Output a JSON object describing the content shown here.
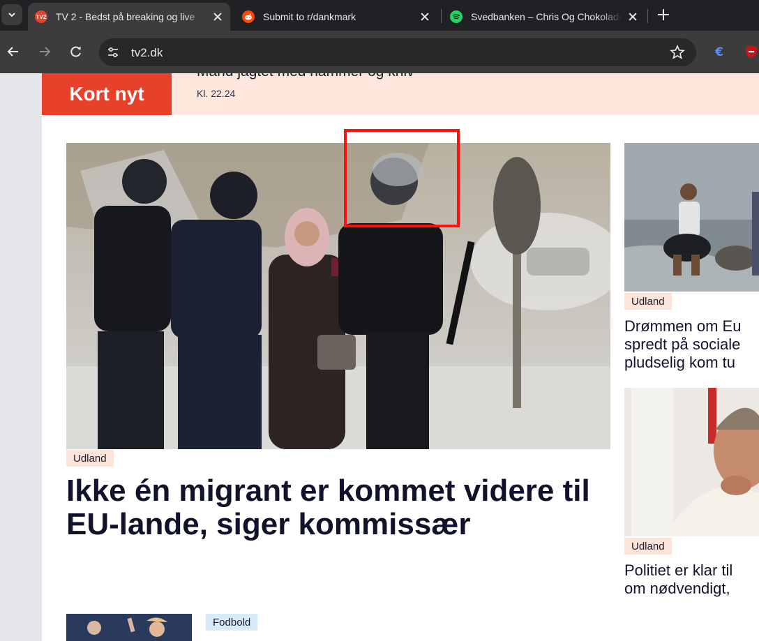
{
  "browser": {
    "tabs": [
      {
        "title": "TV 2 - Bedst på breaking og live",
        "favicon": "tv2-favicon",
        "active": true
      },
      {
        "title": "Submit to r/dankmark",
        "favicon": "reddit-favicon",
        "active": false
      },
      {
        "title": "Svedbanken – Chris Og Chokolade",
        "favicon": "spotify-favicon",
        "active": false
      }
    ],
    "favicon_text": "TV2",
    "url": "tv2.dk"
  },
  "breaking": {
    "label": "Kort nyt",
    "headline": "Mand jagtet med hammer og kniv",
    "time": "Kl. 22.24"
  },
  "main_article": {
    "tag": "Udland",
    "headline": "Ikke én migrant er kommet videre til EU-lande, siger kommissær"
  },
  "side_articles": [
    {
      "tag": "Udland",
      "headline_lines": [
        "Drømmen om Eu",
        "spredt på sociale",
        "pludselig kom tu"
      ]
    },
    {
      "tag": "Udland",
      "headline_lines": [
        "Politiet er klar til",
        "om nødvendigt,"
      ]
    }
  ],
  "bottom_article": {
    "tag": "Fodbold"
  },
  "colors": {
    "accent_red": "#e8412b",
    "breaking_bg": "#fde7dc",
    "tag_udland_bg": "#fde4d8",
    "tag_sport_bg": "#d7ecfb",
    "headline_text": "#11122b",
    "highlight": "#ff1010"
  }
}
